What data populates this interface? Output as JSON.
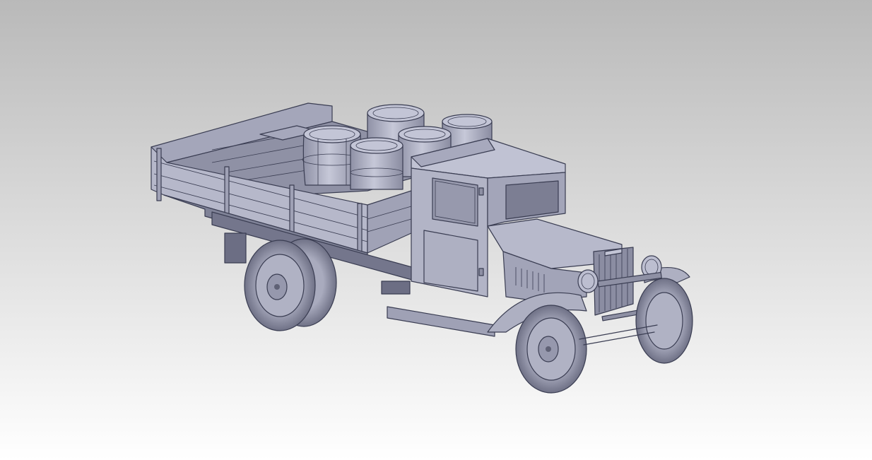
{
  "scene": {
    "subject": "truck-model",
    "colors": {
      "background_top": "#b9b9b9",
      "background_bottom": "#ffffff",
      "body_light": "#b3b5c7",
      "body_mid": "#9c9eb2",
      "body_dark": "#7d8096",
      "body_shadow": "#64667a",
      "edge": "#3a3d52"
    }
  }
}
